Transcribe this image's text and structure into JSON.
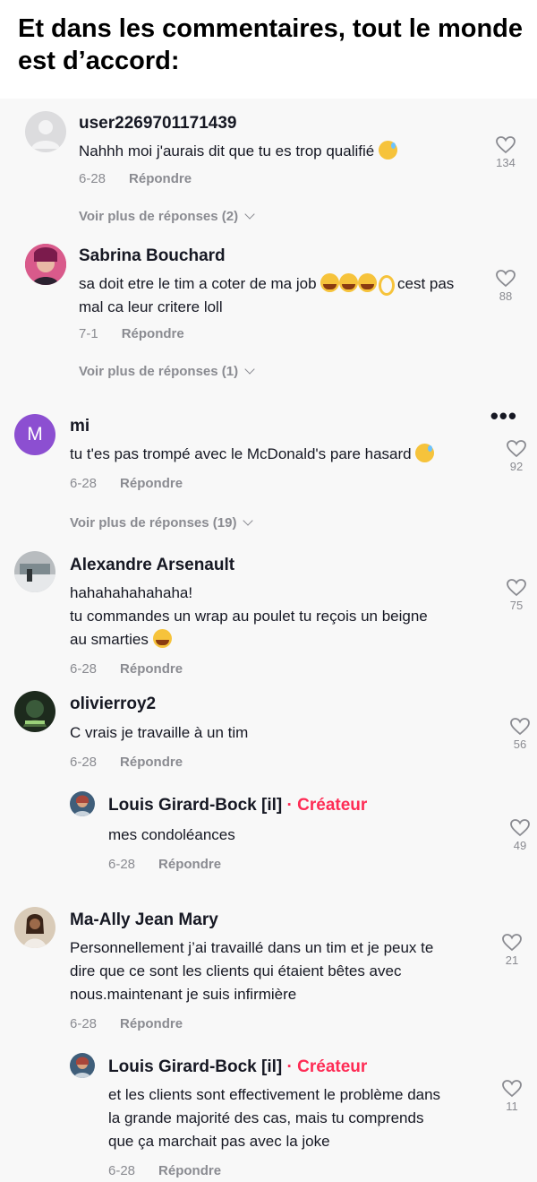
{
  "header": {
    "title": "Et dans les commentaires, tout le monde est d’accord:"
  },
  "menu": {
    "dots": "•••"
  },
  "comments": [
    {
      "user": "user2269701171439",
      "text": "Nahhh moi j'aurais dit que tu es trop qualifié",
      "date": "6-28",
      "reply": "Répondre",
      "likes": "134",
      "more": "Voir plus de réponses (2)"
    },
    {
      "user": "Sabrina Bouchard",
      "text1": "sa doit etre le tim a coter de ma job",
      "text2": " cest pas",
      "text3": "mal ca leur critere loll",
      "date": "7-1",
      "reply": "Répondre",
      "likes": "88",
      "more": "Voir plus de réponses (1)"
    },
    {
      "user": "mi",
      "avatar_letter": "M",
      "text": "tu t'es pas trompé avec le McDonald's pare hasard",
      "date": "6-28",
      "reply": "Répondre",
      "likes": "92",
      "more": "Voir plus de réponses (19)"
    },
    {
      "user": "Alexandre Arsenault",
      "line1": "hahahahahahaha!",
      "line2": "tu commandes un wrap au poulet tu reçois un beigne",
      "line3": "au smarties",
      "date": "6-28",
      "reply": "Répondre",
      "likes": "75"
    },
    {
      "user": "olivierroy2",
      "text": "C vrais je travaille à un tim",
      "date": "6-28",
      "reply": "Répondre",
      "likes": "56"
    },
    {
      "user": "Louis Girard-Bock [il]",
      "sep": " · ",
      "creator": "Créateur",
      "text": "mes condoléances",
      "date": "6-28",
      "reply": "Répondre",
      "likes": "49"
    },
    {
      "user": "Ma-Ally Jean Mary",
      "line1": "Personnellement j’ai travaillé dans un tim et je peux te",
      "line2": "dire que ce sont les clients qui étaient bêtes avec",
      "line3": "nous.maintenant je suis infirmière",
      "date": "6-28",
      "reply": "Répondre",
      "likes": "21"
    },
    {
      "user": "Louis Girard-Bock [il]",
      "sep": " · ",
      "creator": "Créateur",
      "line1": "et les clients sont effectivement le problème dans",
      "line2": "la grande majorité des cas, mais tu comprends",
      "line3": "que ça marchait pas avec la joke",
      "date": "6-28",
      "reply": "Répondre",
      "likes": "11"
    }
  ],
  "colors": {
    "creator": "#fe2c55",
    "muted": "#8a8b91",
    "avatar_m": "#8c4fd1"
  }
}
